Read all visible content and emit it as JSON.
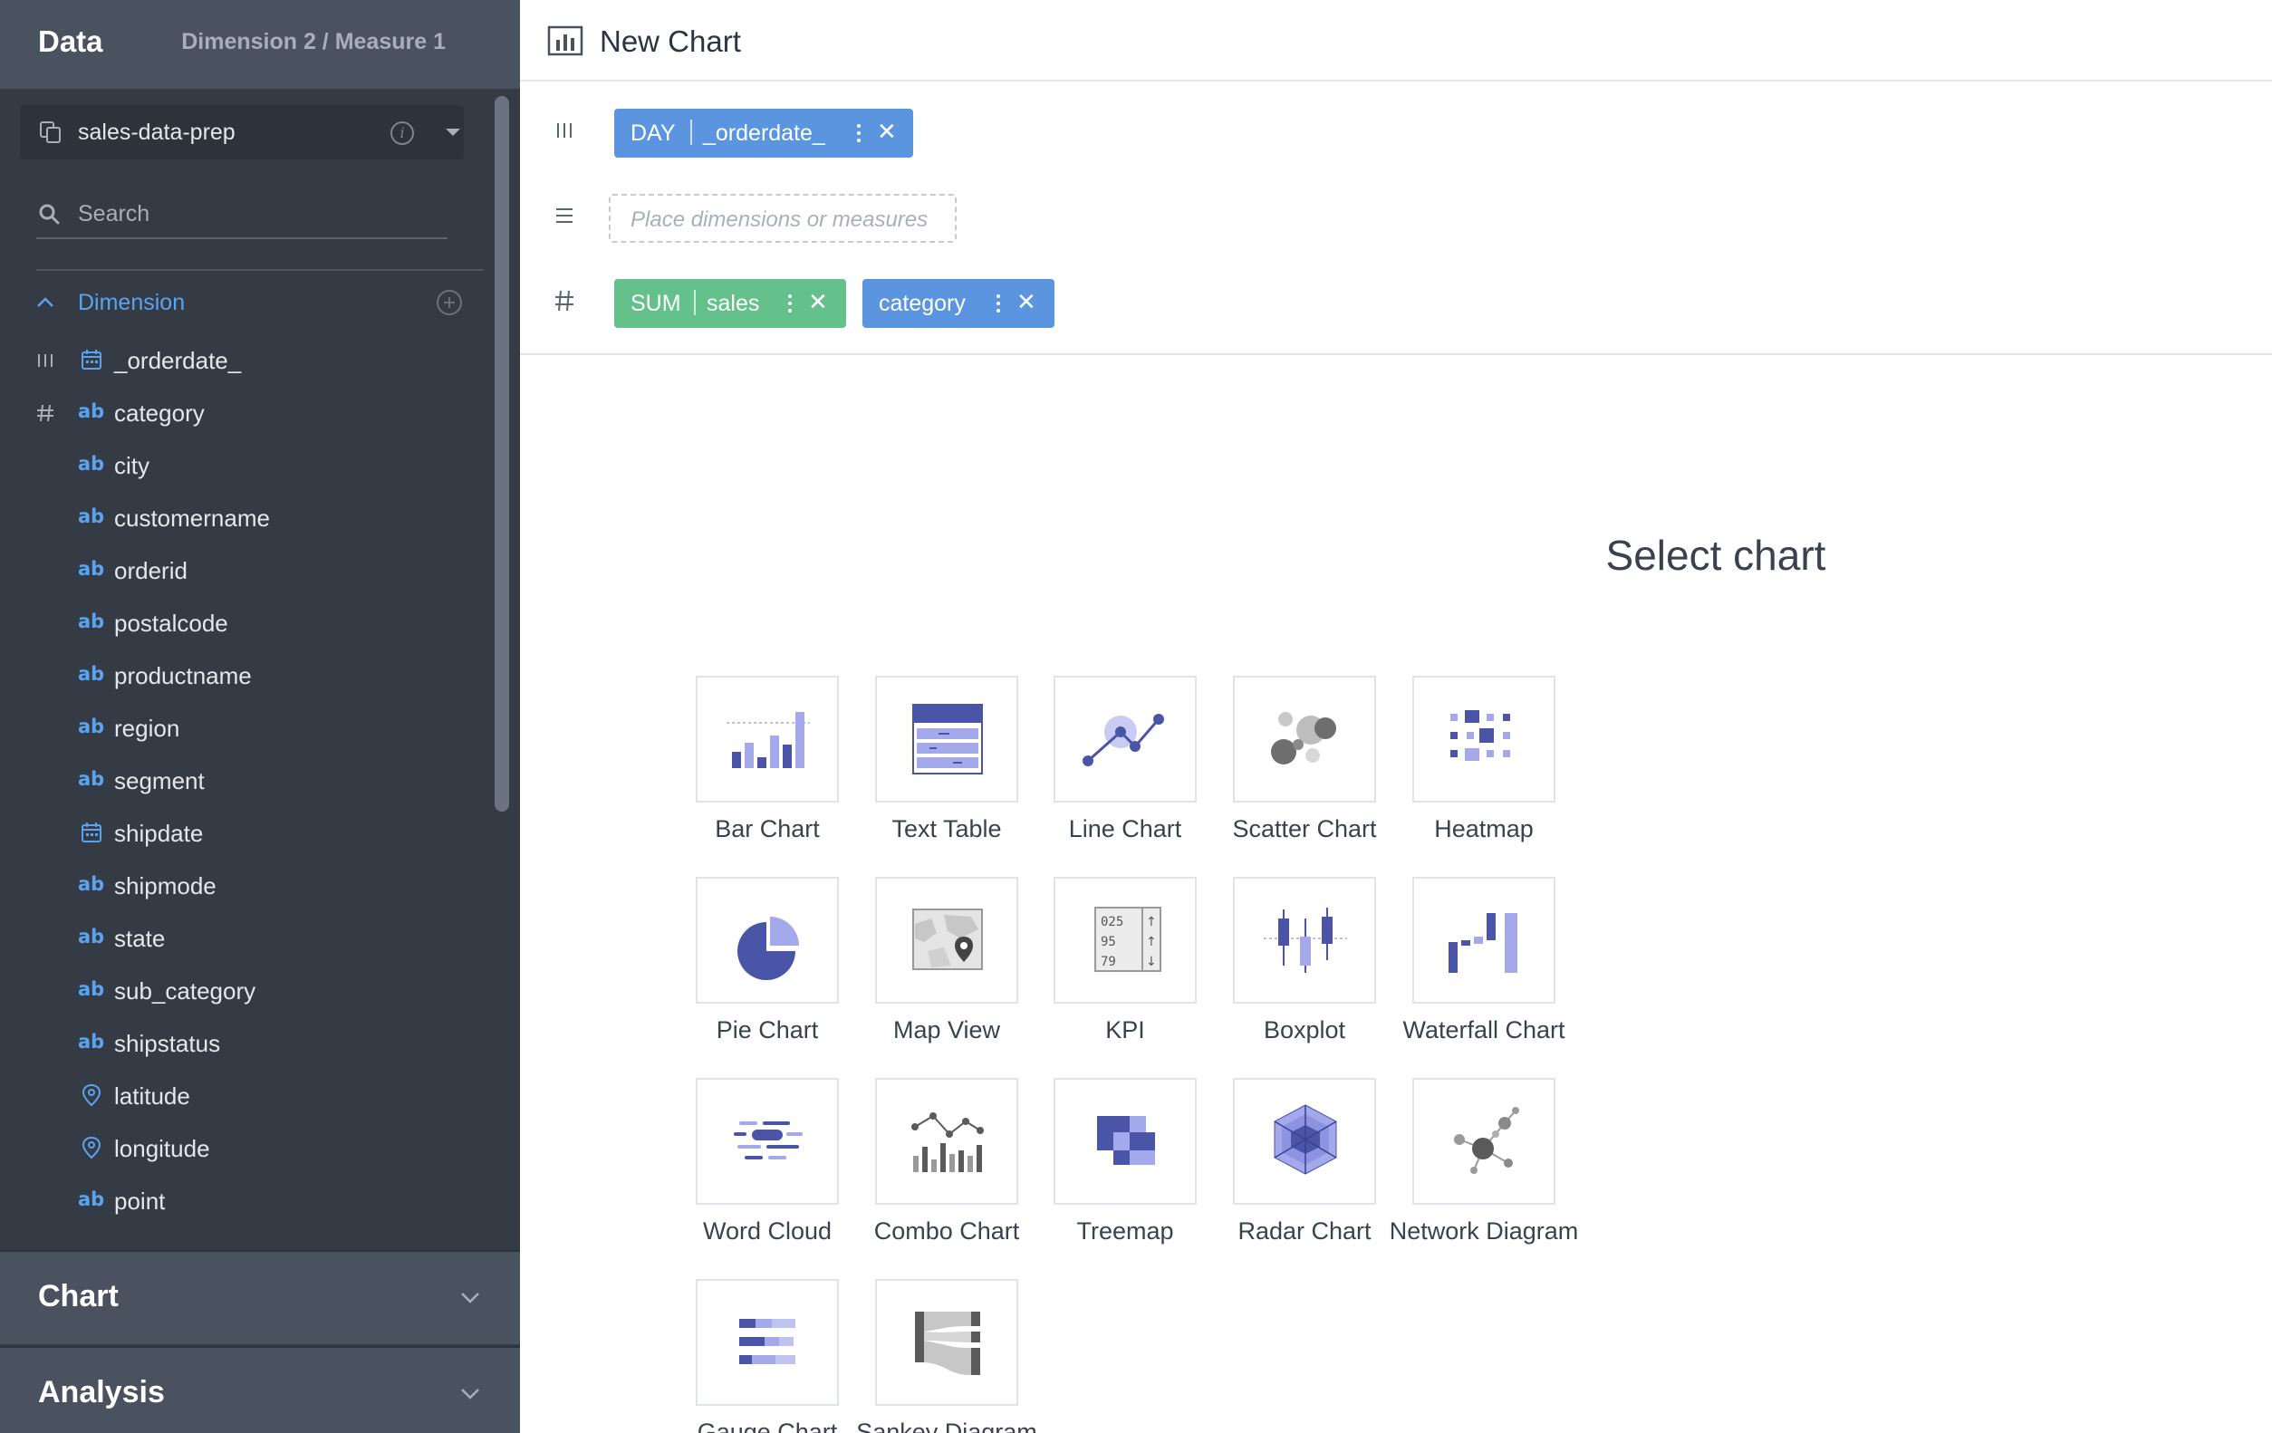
{
  "sidebar": {
    "title": "Data",
    "subtitle": "Dimension 2 / Measure 1",
    "datasource": "sales-data-prep",
    "search_placeholder": "Search",
    "dimension_label": "Dimension",
    "fields": [
      {
        "name": "_orderdate_",
        "type": "date-icon",
        "shelf": "column-shelf-icon"
      },
      {
        "name": "category",
        "type": "ab",
        "shelf": "measure-shelf-icon"
      },
      {
        "name": "city",
        "type": "ab"
      },
      {
        "name": "customername",
        "type": "ab"
      },
      {
        "name": "orderid",
        "type": "ab"
      },
      {
        "name": "postalcode",
        "type": "ab"
      },
      {
        "name": "productname",
        "type": "ab"
      },
      {
        "name": "region",
        "type": "ab"
      },
      {
        "name": "segment",
        "type": "ab"
      },
      {
        "name": "shipdate",
        "type": "date-icon"
      },
      {
        "name": "shipmode",
        "type": "ab"
      },
      {
        "name": "state",
        "type": "ab"
      },
      {
        "name": "sub_category",
        "type": "ab"
      },
      {
        "name": "shipstatus",
        "type": "ab"
      },
      {
        "name": "latitude",
        "type": "pin-icon"
      },
      {
        "name": "longitude",
        "type": "pin-icon"
      },
      {
        "name": "point",
        "type": "ab"
      }
    ],
    "type_ab_text": "ab",
    "chart_section": "Chart",
    "analysis_section": "Analysis"
  },
  "main": {
    "title": "New Chart",
    "shelves": {
      "column": {
        "agg": "DAY",
        "field": "_orderdate_"
      },
      "row": {
        "placeholder": "Place dimensions or measures"
      },
      "measure": [
        {
          "agg": "SUM",
          "field": "sales",
          "color": "#65c18c"
        },
        {
          "field": "category",
          "color": "#5b95e0"
        }
      ]
    },
    "select_title": "Select chart",
    "charts": [
      {
        "label": "Bar Chart",
        "icon": "bar-chart-icon"
      },
      {
        "label": "Text Table",
        "icon": "text-table-icon"
      },
      {
        "label": "Line Chart",
        "icon": "line-chart-icon"
      },
      {
        "label": "Scatter Chart",
        "icon": "scatter-chart-icon"
      },
      {
        "label": "Heatmap",
        "icon": "heatmap-icon"
      },
      {
        "label": "Pie Chart",
        "icon": "pie-chart-icon"
      },
      {
        "label": "Map View",
        "icon": "map-view-icon"
      },
      {
        "label": "KPI",
        "icon": "kpi-icon"
      },
      {
        "label": "Boxplot",
        "icon": "boxplot-icon"
      },
      {
        "label": "Waterfall Chart",
        "icon": "waterfall-chart-icon"
      },
      {
        "label": "Word Cloud",
        "icon": "word-cloud-icon"
      },
      {
        "label": "Combo Chart",
        "icon": "combo-chart-icon"
      },
      {
        "label": "Treemap",
        "icon": "treemap-icon"
      },
      {
        "label": "Radar Chart",
        "icon": "radar-chart-icon"
      },
      {
        "label": "Network Diagram",
        "icon": "network-diagram-icon"
      },
      {
        "label": "Gauge Chart",
        "icon": "gauge-chart-icon"
      },
      {
        "label": "Sankey Diagram",
        "icon": "sankey-diagram-icon"
      }
    ],
    "kpi_numbers": [
      "025",
      "95",
      "79"
    ]
  },
  "colors": {
    "sidebar_bg": "#353b45",
    "sidebar_header": "#4a5260",
    "accent_blue": "#5b95e0",
    "accent_green": "#65c18c",
    "icon_indigo": "#4b55a8",
    "icon_lavender": "#a3a9ea"
  }
}
